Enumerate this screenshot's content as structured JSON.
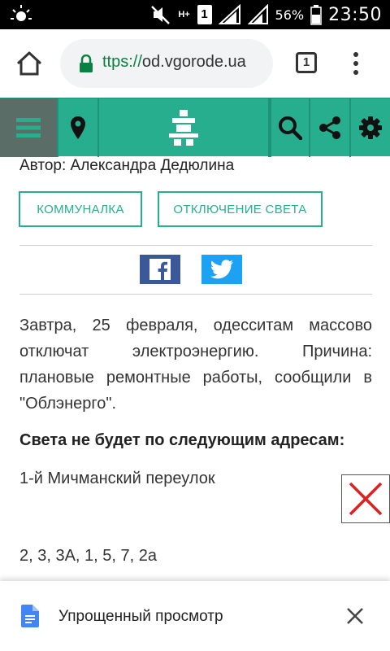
{
  "status_bar": {
    "network_type": "H+",
    "sim_slot": "1",
    "battery_percent": "56%",
    "time": "23:50"
  },
  "browser": {
    "url_scheme_fragment": "ttps://",
    "url_host": "od.vgorode.ua",
    "tab_count": "1"
  },
  "header": {
    "icons": [
      "hamburger-menu-icon",
      "map-pin-icon",
      "site-logo-icon",
      "search-icon",
      "share-icon",
      "gear-icon"
    ],
    "accent_color": "#27ae8f",
    "menu_bg_color": "#5a6e67"
  },
  "article": {
    "author": "Автор: Александра Дедюлина",
    "tags": [
      "КОММУНАЛКА",
      "ОТКЛЮЧЕНИЕ СВЕТА"
    ],
    "share_buttons": {
      "facebook_color": "#3b5998",
      "twitter_color": "#1da1f2"
    },
    "paragraph": "Завтра, 25 февраля, одесситам массово отключат электроэнергию. Причина: плановые ремонтные работы, сообщили в \"Облэнерго\".",
    "list_heading": "Света не будет по следующим адресам:",
    "street": "1-й Мичманский переулок",
    "house_numbers": "2, 3, 3А, 1, 5, 7, 2а"
  },
  "bottom_bar": {
    "label": "Упрощенный просмотр"
  }
}
